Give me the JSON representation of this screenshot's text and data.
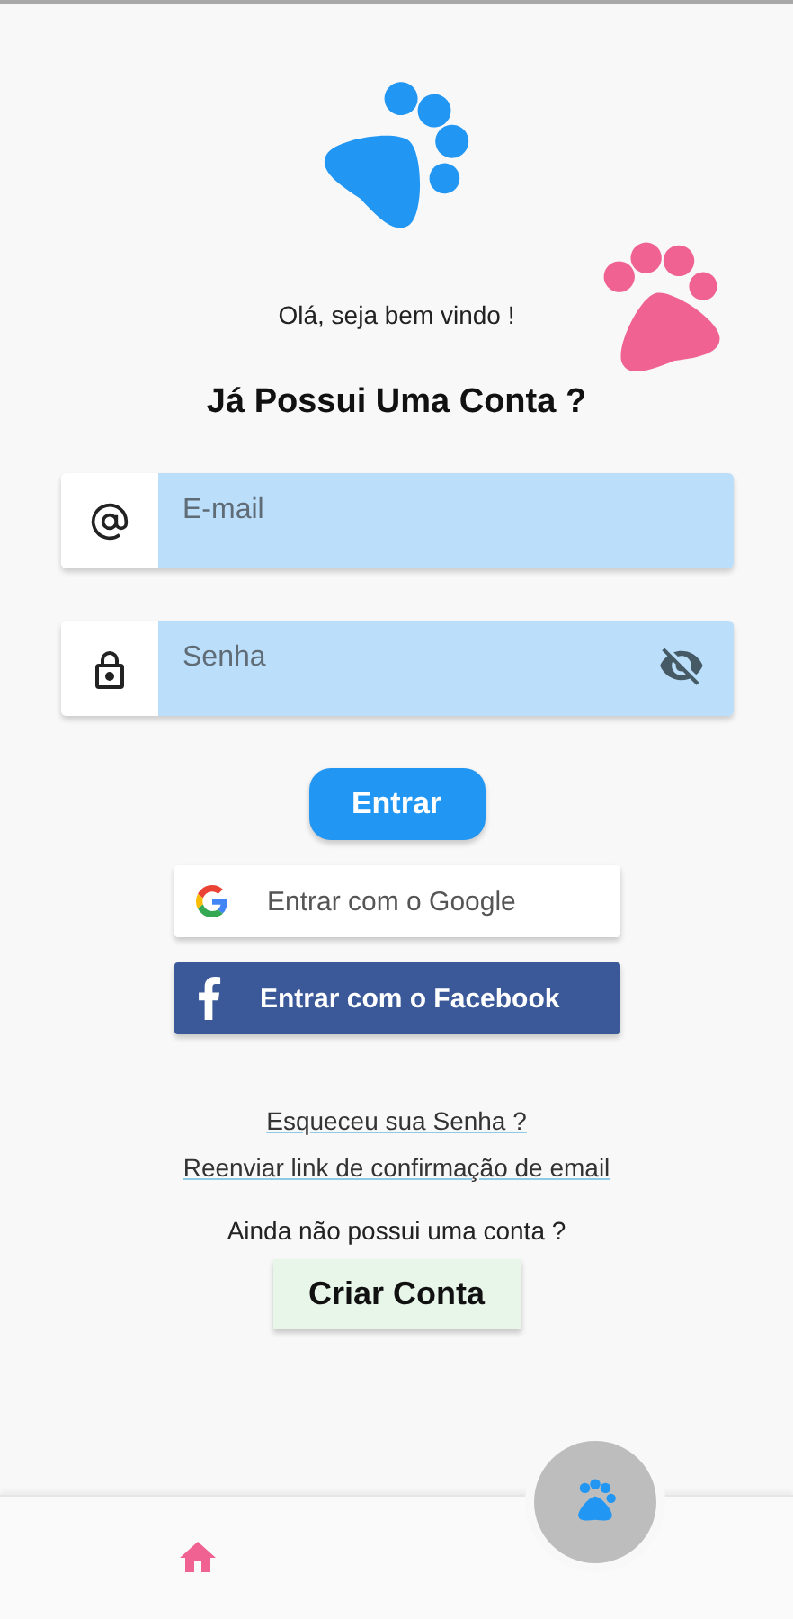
{
  "greeting": "Olá, seja bem vindo !",
  "title": "Já Possui Uma Conta ?",
  "fields": [
    {
      "kind": "email",
      "placeholder": "E-mail"
    },
    {
      "kind": "password",
      "placeholder": "Senha"
    }
  ],
  "login_button": "Entrar",
  "social_buttons": [
    {
      "kind": "google",
      "label": "Entrar com o Google"
    },
    {
      "kind": "facebook",
      "label": "Entrar com o Facebook"
    }
  ],
  "links": [
    "Esqueceu sua Senha ?",
    "Reenviar link de confirmação de email"
  ],
  "signup_prompt": "Ainda não possui uma conta ?",
  "signup_button": "Criar Conta",
  "bottom_nav": [
    {
      "kind": "home"
    }
  ],
  "fab": {
    "kind": "paw"
  }
}
